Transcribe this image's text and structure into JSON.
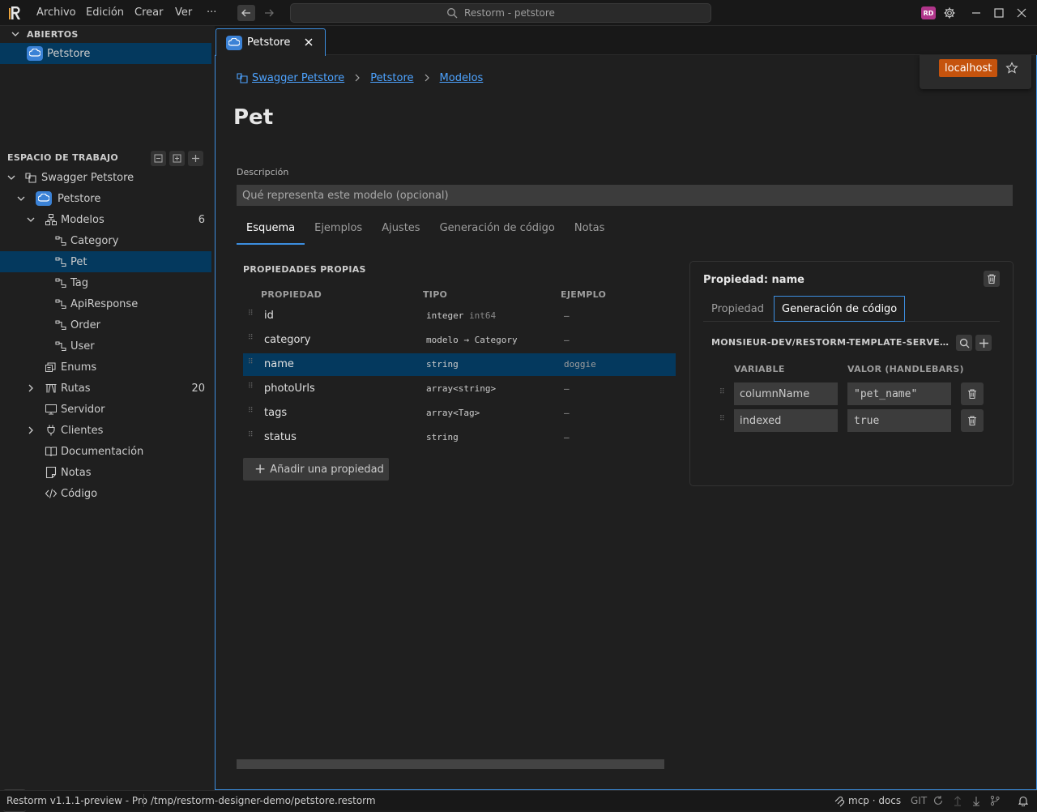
{
  "titlebar": {
    "menus": [
      "Archivo",
      "Edición",
      "Crear",
      "Ver",
      "···"
    ],
    "command_center": "Restorm - petstore",
    "avatar": "RD"
  },
  "sidebar": {
    "open_header": "ABIERTOS",
    "open_items": [
      {
        "label": "Petstore"
      }
    ],
    "workspace_header": "ESPACIO DE TRABAJO",
    "tree": {
      "root": "Swagger Petstore",
      "api": "Petstore",
      "models": {
        "label": "Modelos",
        "count": "6"
      },
      "model_items": [
        "Category",
        "Pet",
        "Tag",
        "ApiResponse",
        "Order",
        "User"
      ],
      "enums": "Enums",
      "routes": {
        "label": "Rutas",
        "count": "20"
      },
      "server": "Servidor",
      "clients": "Clientes",
      "docs": "Documentación",
      "notes": "Notas",
      "code": "Código"
    }
  },
  "editor": {
    "tab_label": "Petstore",
    "environment": "localhost",
    "breadcrumb": [
      "Swagger Petstore",
      "Petstore",
      "Modelos"
    ],
    "title": "Pet",
    "description_label": "Descripción",
    "description_placeholder": "Qué representa este modelo (opcional)",
    "tabs": [
      "Esquema",
      "Ejemplos",
      "Ajustes",
      "Generación de código",
      "Notas"
    ],
    "properties_header": "PROPIEDADES PROPIAS",
    "columns": [
      "PROPIEDAD",
      "TIPO",
      "EJEMPLO"
    ],
    "properties": [
      {
        "name": "id",
        "type": "integer",
        "format": "int64",
        "example": "–"
      },
      {
        "name": "category",
        "type": "modelo → Category",
        "format": "",
        "example": "–"
      },
      {
        "name": "name",
        "type": "string",
        "format": "",
        "example": "doggie"
      },
      {
        "name": "photoUrls",
        "type": "array<string>",
        "format": "",
        "example": "–"
      },
      {
        "name": "tags",
        "type": "array<Tag>",
        "format": "",
        "example": "–"
      },
      {
        "name": "status",
        "type": "string",
        "format": "",
        "example": "–"
      }
    ],
    "add_property": "Añadir una propiedad",
    "detail": {
      "title": "Propiedad: name",
      "tabs": [
        "Propiedad",
        "Generación de código"
      ],
      "repo": "MONSIEUR-DEV/RESTORM-TEMPLATE-SERVER-RE...",
      "var_header": "VARIABLE",
      "val_header": "VALOR (HANDLEBARS)",
      "variables": [
        {
          "name": "columnName",
          "value": "\"pet_name\""
        },
        {
          "name": "indexed",
          "value": "true"
        }
      ]
    }
  },
  "statusbar": {
    "version": "Restorm v1.1.1-preview - Pro",
    "path": "/tmp/restorm-designer-demo/petstore.restorm",
    "mcp": "mcp · docs",
    "git": "GIT"
  },
  "colors": {
    "accent": "#3c8ee0",
    "selection": "#04395e",
    "env_badge": "#c5530d",
    "avatar": "#b0358a"
  }
}
